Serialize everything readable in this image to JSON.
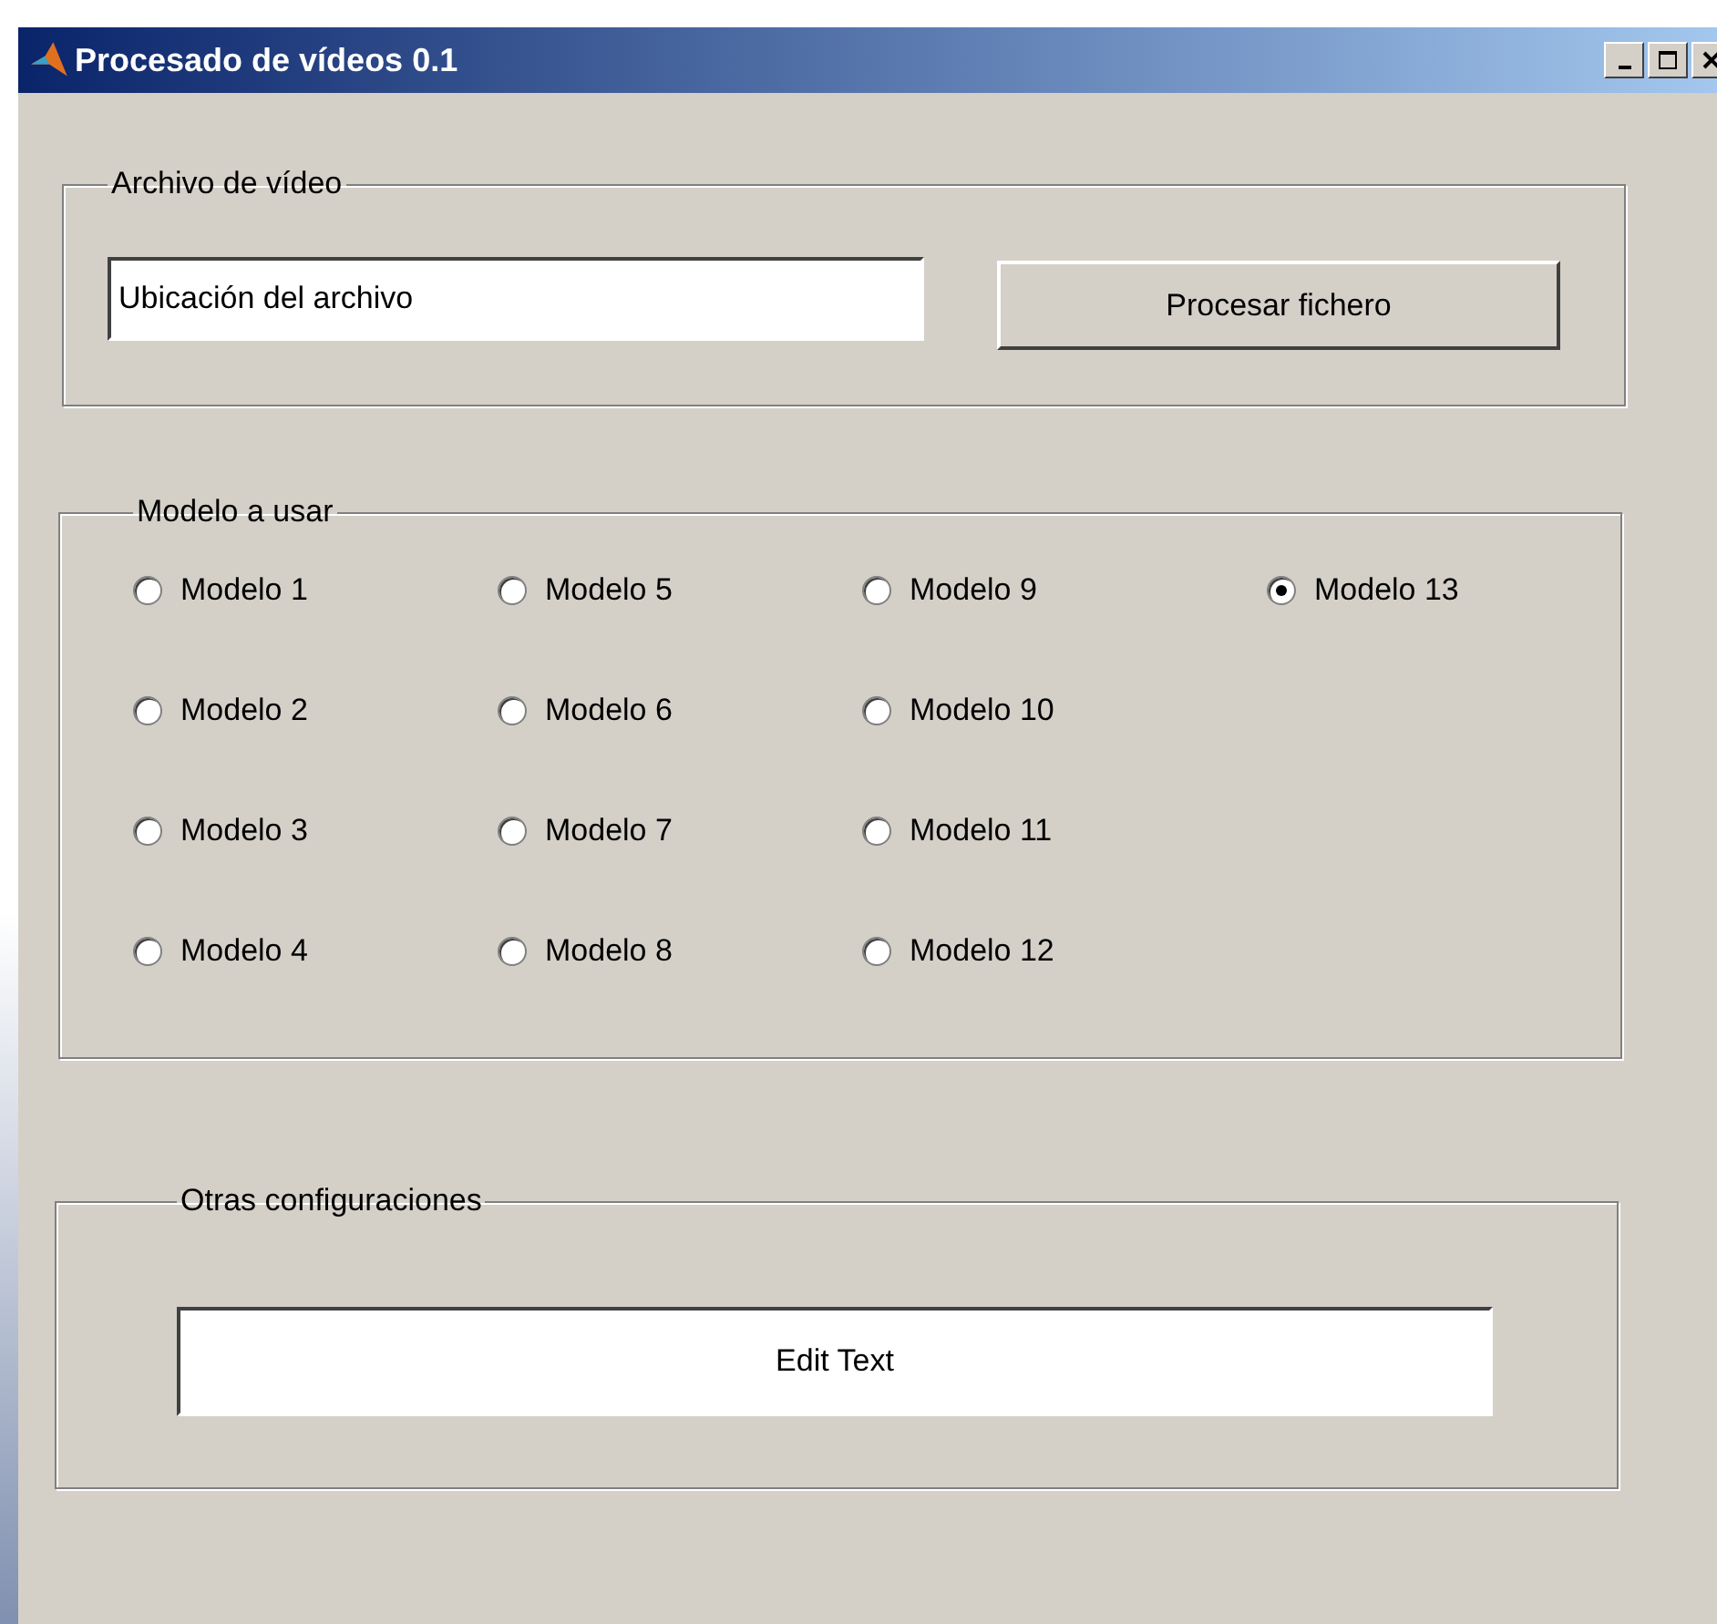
{
  "window": {
    "title": "Procesado de vídeos 0.1"
  },
  "file_panel": {
    "title": "Archivo de vídeo",
    "path_value": "Ubicación del archivo",
    "button": "Procesar fichero"
  },
  "model_panel": {
    "title": "Modelo a usar",
    "columns": [
      [
        {
          "label": "Modelo 1",
          "selected": false
        },
        {
          "label": "Modelo 2",
          "selected": false
        },
        {
          "label": "Modelo 3",
          "selected": false
        },
        {
          "label": "Modelo 4",
          "selected": false
        }
      ],
      [
        {
          "label": "Modelo 5",
          "selected": false
        },
        {
          "label": "Modelo 6",
          "selected": false
        },
        {
          "label": "Modelo 7",
          "selected": false
        },
        {
          "label": "Modelo 8",
          "selected": false
        }
      ],
      [
        {
          "label": "Modelo 9",
          "selected": false
        },
        {
          "label": "Modelo 10",
          "selected": false
        },
        {
          "label": "Modelo 11",
          "selected": false
        },
        {
          "label": "Modelo 12",
          "selected": false
        }
      ],
      [
        {
          "label": "Modelo 13",
          "selected": true
        }
      ]
    ]
  },
  "other_panel": {
    "title": "Otras configuraciones",
    "edit_value": "Edit Text"
  }
}
